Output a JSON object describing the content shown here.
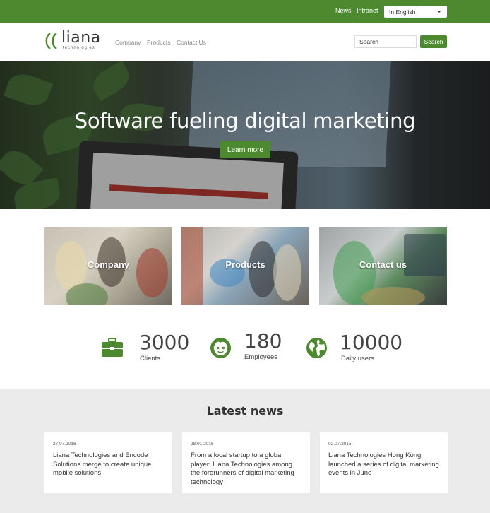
{
  "topbar": {
    "news": "News",
    "intranet": "Intranet",
    "language": "In English"
  },
  "header": {
    "logo_word": "liana",
    "logo_tag": "technologies",
    "nav": [
      "Company",
      "Products",
      "Contact Us"
    ],
    "search_value": "Search",
    "search_button": "Search"
  },
  "hero": {
    "title": "Software fueling digital marketing",
    "button": "Learn more"
  },
  "tiles": [
    "Company",
    "Products",
    "Contact us"
  ],
  "stats": [
    {
      "value": "3000",
      "label": "Clients",
      "icon": "briefcase-icon"
    },
    {
      "value": "180",
      "label": "Employees",
      "icon": "face-icon"
    },
    {
      "value": "10000",
      "label": "Daily users",
      "icon": "globe-icon"
    }
  ],
  "news": {
    "heading": "Latest news",
    "items": [
      {
        "date": "27.07.2016",
        "title": "Liana Technologies and Encode Solutions merge to create unique mobile solutions"
      },
      {
        "date": "28.01.2016",
        "title": "From a local startup to a global player: Liana Technologies among the forerunners of digital marketing technology"
      },
      {
        "date": "02.07.2015",
        "title": "Liana Technologies Hong Kong launched a series of digital marketing events in June"
      }
    ]
  },
  "colors": {
    "brand_green": "#4d8a2f",
    "news_bg": "#ebebeb"
  }
}
